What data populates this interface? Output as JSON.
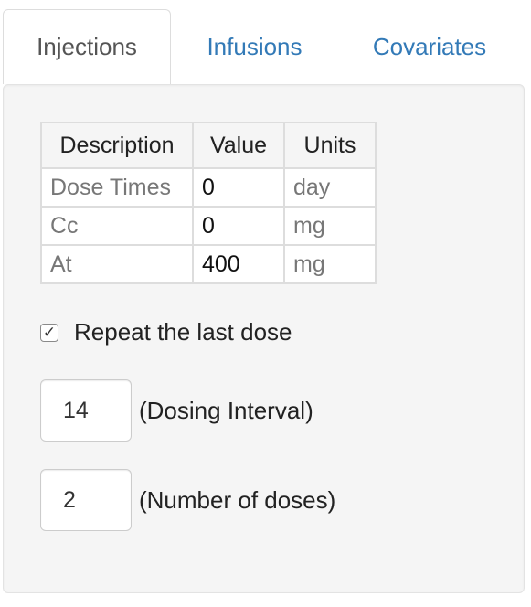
{
  "tabs": [
    {
      "label": "Injections",
      "active": true
    },
    {
      "label": "Infusions",
      "active": false
    },
    {
      "label": "Covariates",
      "active": false
    }
  ],
  "table": {
    "headers": [
      "Description",
      "Value",
      "Units"
    ],
    "rows": [
      {
        "description": "Dose Times",
        "value": "0",
        "units": "day"
      },
      {
        "description": "Cc",
        "value": "0",
        "units": "mg"
      },
      {
        "description": "At",
        "value": "400",
        "units": "mg"
      }
    ]
  },
  "repeat": {
    "label": "Repeat the last dose",
    "checked": true,
    "check_glyph": "✓"
  },
  "interval": {
    "value": "14",
    "label": "(Dosing Interval)"
  },
  "num_doses": {
    "value": "2",
    "label": "(Number of doses)"
  },
  "colors": {
    "link": "#337ab7",
    "active_tab_text": "#555555",
    "panel_bg": "#f5f5f5"
  }
}
